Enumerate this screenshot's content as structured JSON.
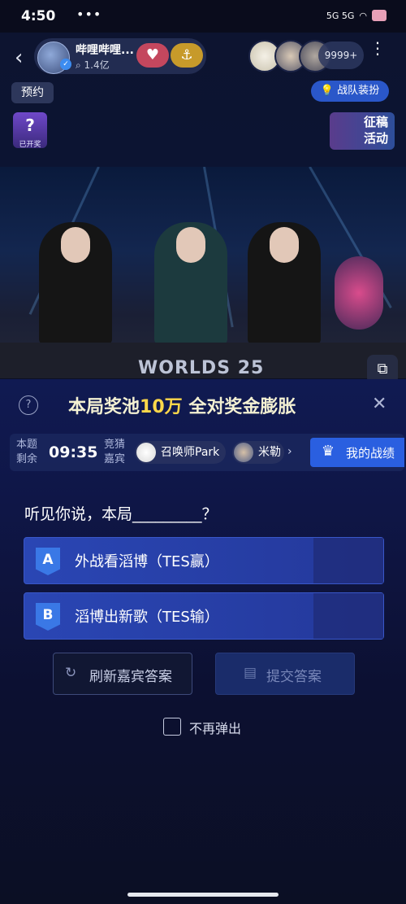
{
  "status_bar": {
    "time": "4:50",
    "dots": "•••",
    "network": "5G 5G"
  },
  "header": {
    "streamer_name": "哔哩哔哩...",
    "viewers": "1.4亿",
    "follow_icon": "heart-plus-icon",
    "anchor_icon": "anchor-icon",
    "audience_count": "9999+",
    "reserve_label": "预约",
    "team_outfit_label": "战队装扮",
    "lottery_label": "已开奖",
    "event_banner_label": "征稿活动"
  },
  "video": {
    "logo_text": "WORLDS 25"
  },
  "quiz": {
    "pool_prefix": "本局奖池",
    "pool_amount": "10万",
    "pool_suffix": "全对奖金膨胀",
    "remain_label_1": "本题",
    "remain_label_2": "剩余",
    "timer": "09:35",
    "guess_label_1": "竞猜",
    "guess_label_2": "嘉宾",
    "guests": [
      {
        "name": "召唤师Park"
      },
      {
        "name": "米勒"
      }
    ],
    "my_record_label": "我的战绩",
    "question": "听见你说，本局_________？",
    "options": [
      {
        "letter": "A",
        "text": "外战看滔博（TES赢）"
      },
      {
        "letter": "B",
        "text": "滔博出新歌（TES输）"
      }
    ],
    "refresh_label": "刷新嘉宾答案",
    "submit_label": "提交答案",
    "no_popup_label": "不再弹出"
  },
  "colors": {
    "accent": "#2a5fe0",
    "gold": "#ffd84a",
    "follow": "#c4475e"
  }
}
